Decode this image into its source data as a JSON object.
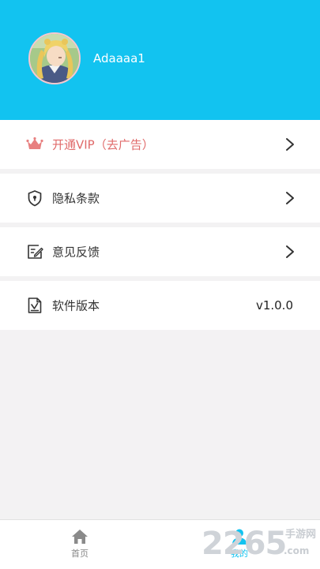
{
  "profile": {
    "username": "Adaaaa1"
  },
  "menu": [
    {
      "key": "vip",
      "label": "开通VIP（去广告）",
      "icon": "crown-icon",
      "color": "#e06a6a",
      "arrow": true
    },
    {
      "key": "privacy",
      "label": "隐私条款",
      "icon": "shield-icon",
      "arrow": true
    },
    {
      "key": "feedback",
      "label": "意见反馈",
      "icon": "feedback-edit-icon",
      "arrow": true
    },
    {
      "key": "version",
      "label": "软件版本",
      "icon": "document-check-icon",
      "value": "v1.0.0",
      "arrow": false
    }
  ],
  "tabbar": {
    "home_label": "首页",
    "mine_label": "我的",
    "active": "mine",
    "active_color": "#12c3f0",
    "inactive_color": "#888888"
  },
  "watermark": {
    "number": "2265",
    "text": "手游网",
    "url": ".com"
  },
  "colors": {
    "header_bg": "#12c3f0",
    "page_bg": "#f3f2f3",
    "vip_accent": "#e06a6a"
  }
}
